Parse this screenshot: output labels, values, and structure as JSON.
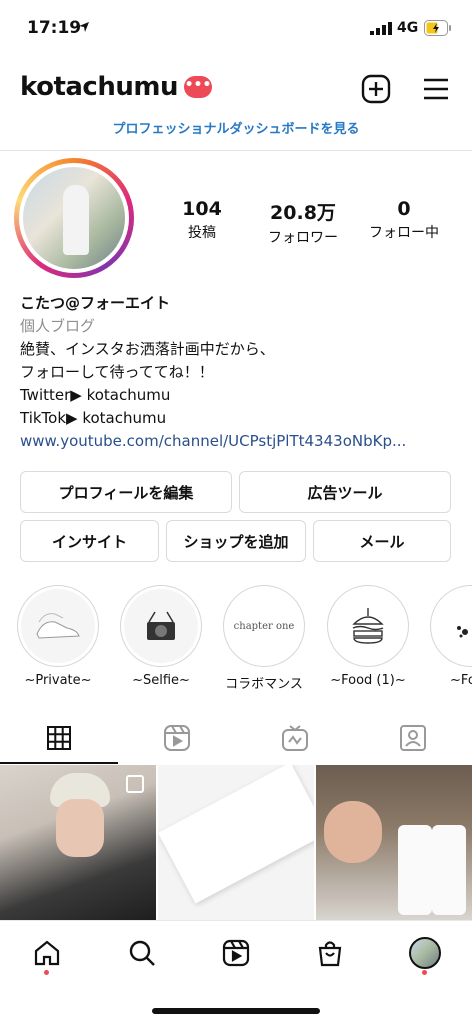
{
  "status_bar": {
    "time": "17:19",
    "network": "4G"
  },
  "header": {
    "username": "kotachumu",
    "badge": "•••"
  },
  "dashboard_link": "プロフェッショナルダッシュボードを見る",
  "stats": [
    {
      "value": "104",
      "label": "投稿"
    },
    {
      "value": "20.8万",
      "label": "フォロワー"
    },
    {
      "value": "0",
      "label": "フォロー中"
    }
  ],
  "bio": {
    "name": "こたつ@フォーエイト",
    "category": "個人ブログ",
    "lines": [
      "絶賛、インスタお洒落計画中だから、",
      "フォローして待っててね！！",
      "Twitter▶ kotachumu",
      "TikTok▶ kotachumu"
    ],
    "link": "www.youtube.com/channel/UCPstjPlTt4343oNbKp..."
  },
  "buttons": {
    "edit_profile": "プロフィールを編集",
    "ad_tools": "広告ツール",
    "insights": "インサイト",
    "add_shop": "ショップを追加",
    "email": "メール"
  },
  "highlights": [
    {
      "label": "~Private~"
    },
    {
      "label": "~Selfie~"
    },
    {
      "label": "コラボマンス",
      "cover_text": "chapter one"
    },
    {
      "label": "~Food (1)~"
    },
    {
      "label": "~Food"
    }
  ],
  "icons": {
    "add": "plus-square-icon",
    "menu": "hamburger-icon",
    "tabs": [
      "grid-icon",
      "reels-icon",
      "igtv-icon",
      "tagged-icon"
    ],
    "nav": [
      "home-icon",
      "search-icon",
      "reels-icon",
      "shop-icon",
      "profile-avatar"
    ]
  },
  "colors": {
    "accent_red": "#ed4956",
    "link_blue": "#2779c4",
    "bio_link": "#2a4f8c"
  }
}
